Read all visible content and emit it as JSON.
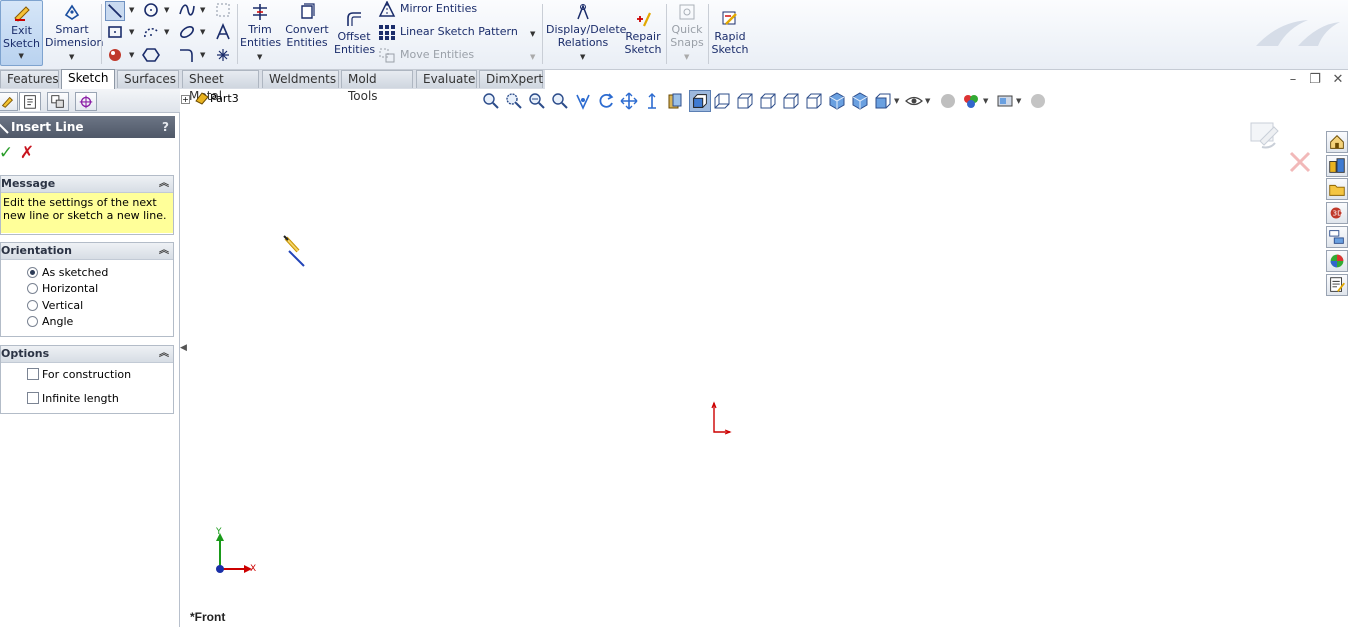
{
  "ribbon": {
    "exit_sketch": "Exit\nSketch",
    "smart_dimension": "Smart\nDimension",
    "trim_entities": "Trim\nEntities",
    "convert_entities": "Convert\nEntities",
    "offset_entities": "Offset\nEntities",
    "mirror_entities": "Mirror Entities",
    "linear_sketch_pattern": "Linear Sketch Pattern",
    "move_entities": "Move Entities",
    "display_delete_relations": "Display/Delete\nRelations",
    "repair_sketch": "Repair\nSketch",
    "quick_snaps": "Quick\nSnaps",
    "rapid_sketch": "Rapid\nSketch"
  },
  "tabs": [
    "Features",
    "Sketch",
    "Surfaces",
    "Sheet Metal",
    "Weldments",
    "Mold Tools",
    "Evaluate",
    "DimXpert"
  ],
  "active_tab": "Sketch",
  "property_manager": {
    "title": "Insert Line",
    "help": "?",
    "ok_glyph": "✓",
    "cancel_glyph": "✗",
    "message": {
      "title": "Message",
      "text": "Edit the settings of the next new line or sketch a new line."
    },
    "orientation": {
      "title": "Orientation",
      "options": [
        "As sketched",
        "Horizontal",
        "Vertical",
        "Angle"
      ],
      "selected": "As sketched"
    },
    "options": {
      "title": "Options",
      "for_construction": "For construction",
      "infinite_length": "Infinite length"
    }
  },
  "feature_tree": {
    "root": "Part3"
  },
  "graphics": {
    "view_label": "*Front",
    "axis_x": "X",
    "axis_y": "Y"
  },
  "window_controls": {
    "minimize": "–",
    "restore": "❐",
    "close": "✕"
  },
  "colors": {
    "accent_blue": "#1b2d6b",
    "message_bg": "#ffff99",
    "header_bg": "#5b6474",
    "origin_red": "#cc0000",
    "axis_green": "#1a9a1a"
  }
}
